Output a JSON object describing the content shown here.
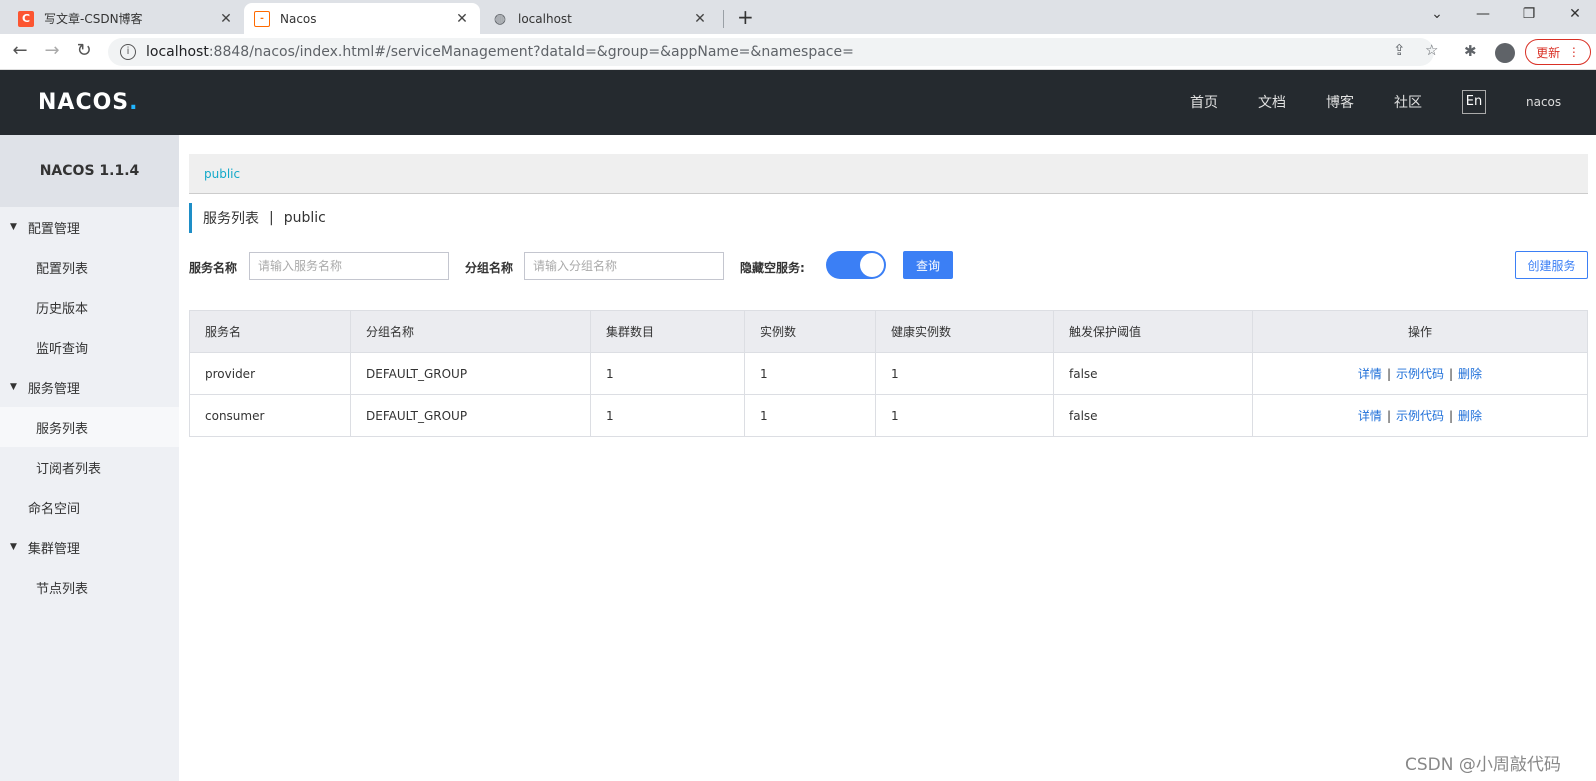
{
  "browser": {
    "tabs": [
      {
        "title": "写文章-CSDN博客",
        "favicon": "C",
        "favicon_color": "#fc5531"
      },
      {
        "title": "Nacos",
        "favicon": "[-]",
        "favicon_color": "#ff6a00"
      },
      {
        "title": "localhost",
        "favicon": "globe-icon"
      }
    ],
    "url_host": "localhost",
    "url_path": ":8848/nacos/index.html#/serviceManagement?dataId=&group=&appName=&namespace=",
    "update_label": "更新"
  },
  "header": {
    "logo_main": "NACOS",
    "logo_dot": ".",
    "nav": [
      "首页",
      "文档",
      "博客",
      "社区"
    ],
    "lang": "En",
    "user": "nacos"
  },
  "sidebar": {
    "version": "NACOS 1.1.4",
    "groups": [
      {
        "label": "配置管理",
        "items": [
          "配置列表",
          "历史版本",
          "监听查询"
        ]
      },
      {
        "label": "服务管理",
        "items": [
          "服务列表",
          "订阅者列表"
        ]
      },
      {
        "label": "命名空间"
      },
      {
        "label": "集群管理",
        "items": [
          "节点列表"
        ]
      }
    ]
  },
  "main": {
    "namespace": "public",
    "title": "服务列表",
    "title_sep": "|",
    "title_ns": "public",
    "filters": {
      "service_label": "服务名称",
      "service_placeholder": "请输入服务名称",
      "group_label": "分组名称",
      "group_placeholder": "请输入分组名称",
      "hide_empty_label": "隐藏空服务:",
      "hide_empty_on": true,
      "query_label": "查询",
      "create_label": "创建服务"
    },
    "table": {
      "columns": [
        "服务名",
        "分组名称",
        "集群数目",
        "实例数",
        "健康实例数",
        "触发保护阈值",
        "操作"
      ],
      "rows": [
        {
          "name": "provider",
          "group": "DEFAULT_GROUP",
          "clusters": "1",
          "instances": "1",
          "healthy": "1",
          "threshold": "false"
        },
        {
          "name": "consumer",
          "group": "DEFAULT_GROUP",
          "clusters": "1",
          "instances": "1",
          "healthy": "1",
          "threshold": "false"
        }
      ],
      "ops": {
        "detail": "详情",
        "sample": "示例代码",
        "delete": "删除",
        "sep": "|"
      }
    }
  },
  "watermark": "CSDN @小周敲代码",
  "colors": {
    "accent": "#3b7ff5",
    "header_bg": "#252a2f",
    "link": "#14a9c9"
  }
}
